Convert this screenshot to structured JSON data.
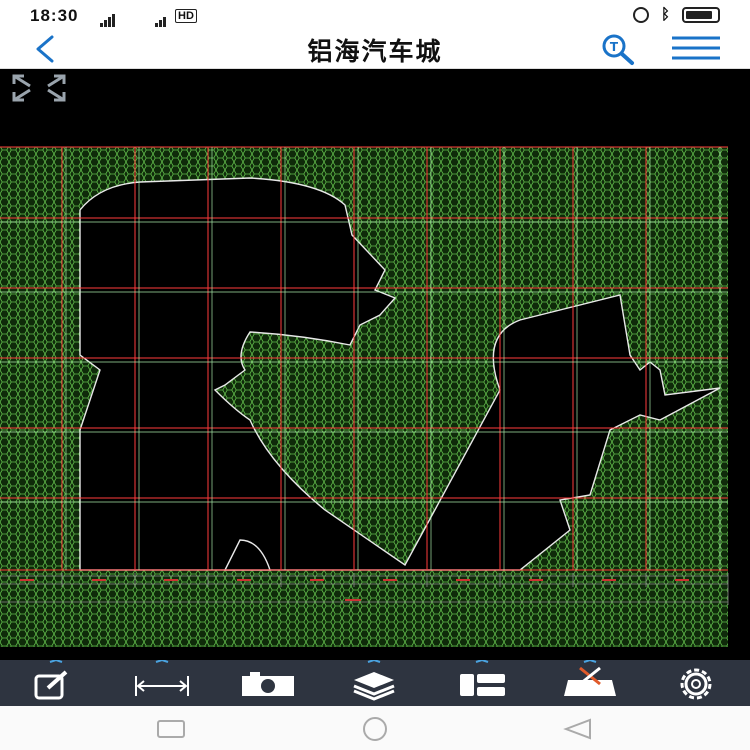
{
  "status_bar": {
    "time": "18:30",
    "network_label": "HD",
    "battery_level": 0.85
  },
  "header": {
    "title": "铝海汽车城",
    "back_icon": "chevron-left-icon",
    "search_icon": "text-search-icon",
    "menu_icon": "hamburger-menu-icon",
    "accent_color": "#1a73c8"
  },
  "drawing": {
    "background_color": "#000000",
    "fill_pattern_color": "#3a7a2a",
    "grid_major_color": "#ff3b3b",
    "grid_minor_color": "#8cff8c",
    "outline_color": "#e8e8e8",
    "dimension_color": "#cc3333"
  },
  "toolbar": {
    "items": [
      {
        "name": "edit-tool",
        "icon": "edit-icon"
      },
      {
        "name": "measure-tool",
        "icon": "measure-icon"
      },
      {
        "name": "camera-tool",
        "icon": "camera-icon"
      },
      {
        "name": "layers-tool",
        "icon": "layers-icon"
      },
      {
        "name": "layout-tool",
        "icon": "layout-icon"
      },
      {
        "name": "toolbox-tool",
        "icon": "toolbox-icon"
      },
      {
        "name": "settings-tool",
        "icon": "gear-icon"
      }
    ]
  },
  "nav_bar": {
    "items": [
      "recent-apps-button",
      "home-button",
      "back-nav-button"
    ]
  }
}
